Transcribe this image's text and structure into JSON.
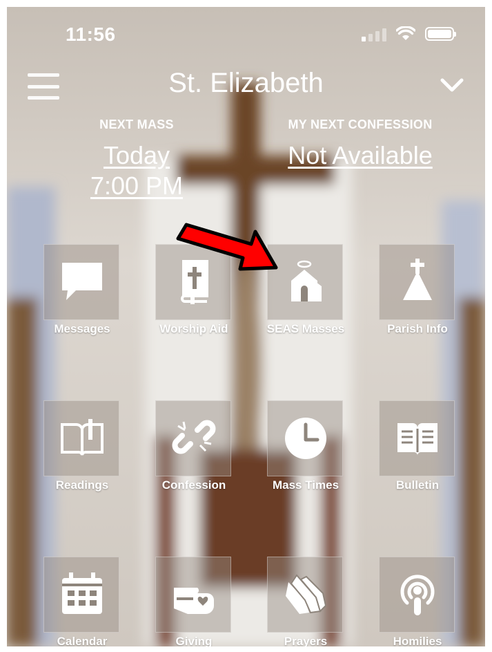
{
  "status_bar": {
    "time": "11:56"
  },
  "header": {
    "title": "St. Elizabeth"
  },
  "next_mass": {
    "label": "NEXT MASS",
    "day": "Today",
    "time": "7:00 PM"
  },
  "confession": {
    "label": "MY NEXT CONFESSION",
    "value": "Not Available"
  },
  "tiles": [
    {
      "label": "Messages",
      "icon": "message-icon"
    },
    {
      "label": "Worship Aid",
      "icon": "bible-icon"
    },
    {
      "label": "SEAS Masses",
      "icon": "church-icon"
    },
    {
      "label": "Parish Info",
      "icon": "parish-icon"
    },
    {
      "label": "Readings",
      "icon": "readings-book-icon"
    },
    {
      "label": "Confession",
      "icon": "broken-chain-icon"
    },
    {
      "label": "Mass Times",
      "icon": "clock-icon"
    },
    {
      "label": "Bulletin",
      "icon": "bulletin-icon"
    },
    {
      "label": "Calendar",
      "icon": "calendar-icon"
    },
    {
      "label": "Giving",
      "icon": "giving-hand-icon"
    },
    {
      "label": "Prayers",
      "icon": "praying-hands-icon"
    },
    {
      "label": "Homilies",
      "icon": "podcast-icon"
    }
  ],
  "colors": {
    "annotation_arrow": "#ff0000",
    "text": "#ffffff"
  }
}
